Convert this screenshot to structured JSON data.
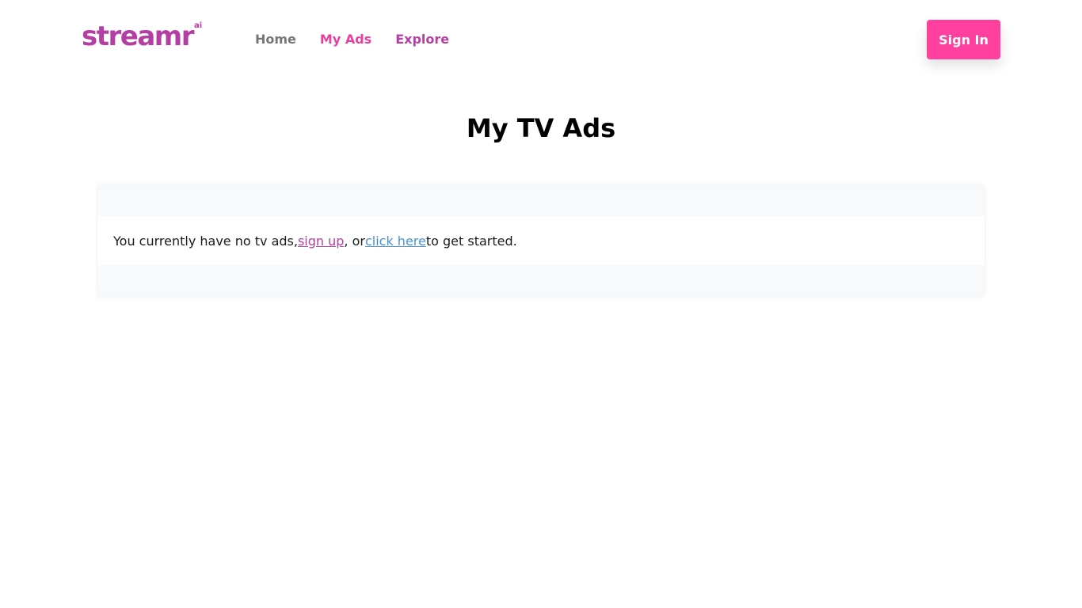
{
  "brand": {
    "name": "streamr",
    "suffix": "ai",
    "color": "#b43ea4"
  },
  "nav": {
    "items": [
      {
        "label": "Home",
        "color": "#757575"
      },
      {
        "label": "My Ads",
        "color": "#e63f9c"
      },
      {
        "label": "Explore",
        "color": "#b43ea4"
      }
    ]
  },
  "header": {
    "signin_label": "Sign In",
    "signin_color": "#ff409f"
  },
  "main": {
    "title": "My TV Ads",
    "empty_state": {
      "text_before": "You currently have no tv ads, ",
      "signup_link": "sign up",
      "signup_color": "#b43ea4",
      "text_middle": ", or ",
      "click_link": "click here",
      "click_color": "#4a90d9",
      "text_after": " to get started."
    }
  }
}
